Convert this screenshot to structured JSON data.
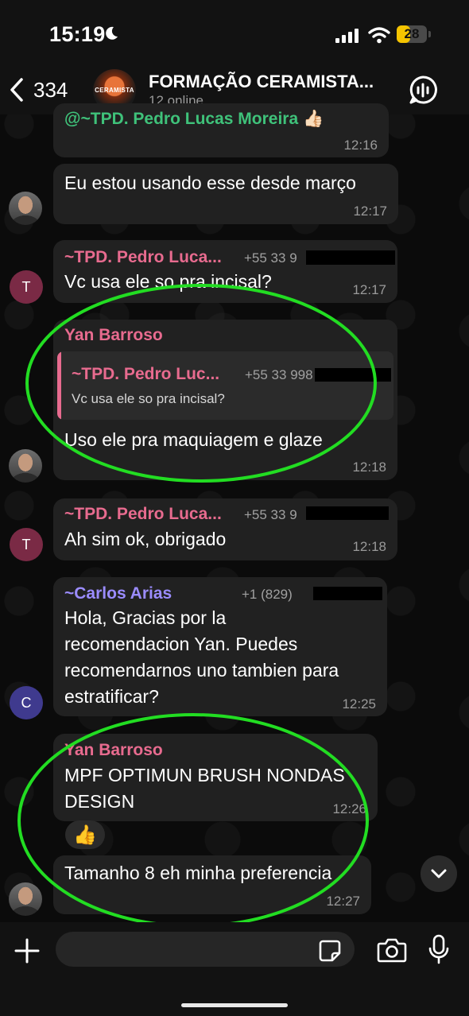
{
  "status_bar": {
    "time": "15:19",
    "battery_level": "28",
    "battery_fraction": 0.28,
    "accent_color": "#f5c400"
  },
  "header": {
    "back_count": "334",
    "title": "FORMAÇÃO CERAMISTA...",
    "subtitle": "12 online",
    "avatar_text": "CERAMISTA"
  },
  "messages": [
    {
      "sender": "@~TPD. Pedro Lucas Moreira 👍🏻",
      "text": "",
      "time": "12:16",
      "sender_color": "#3fc27a"
    },
    {
      "sender": "",
      "text": "Eu estou usando esse desde março",
      "time": "12:17"
    },
    {
      "sender": "~TPD. Pedro Luca...",
      "phone": "+55 33 9",
      "text": "Vc usa ele so pra incisal?",
      "time": "12:17",
      "avatar_letter": "T",
      "sender_color": "#e86b8f"
    },
    {
      "sender": "Yan Barroso",
      "quote_sender": "~TPD. Pedro Luc...",
      "quote_phone": "+55 33 998",
      "quote_text": "Vc usa ele so pra incisal?",
      "text": "Uso ele pra maquiagem e glaze",
      "time": "12:18",
      "sender_color": "#e86b8f"
    },
    {
      "sender": "~TPD. Pedro Luca...",
      "phone": "+55 33 9",
      "text": "Ah sim ok, obrigado",
      "time": "12:18",
      "avatar_letter": "T",
      "sender_color": "#e86b8f"
    },
    {
      "sender": "~Carlos Arias",
      "phone": "+1 (829)",
      "text_lines": [
        "Hola, Gracias por la",
        "recomendacion Yan. Puedes",
        "recomendarnos uno tambien para",
        "estratificar?"
      ],
      "time": "12:25",
      "avatar_letter": "C",
      "sender_color": "#9b8cff"
    },
    {
      "sender": "Yan Barroso",
      "text_lines": [
        "MPF OPTIMUN BRUSH NONDAS",
        "DESIGN"
      ],
      "time": "12:26",
      "reaction": "👍",
      "sender_color": "#e86b8f"
    },
    {
      "sender": "",
      "text": "Tamanho 8 eh minha preferencia",
      "time": "12:27"
    }
  ],
  "input": {
    "placeholder": ""
  },
  "colors": {
    "bubble": "#212121",
    "annotation": "#22dd22",
    "pink": "#e86b8f",
    "purple": "#9b8cff",
    "green": "#3fc27a"
  }
}
